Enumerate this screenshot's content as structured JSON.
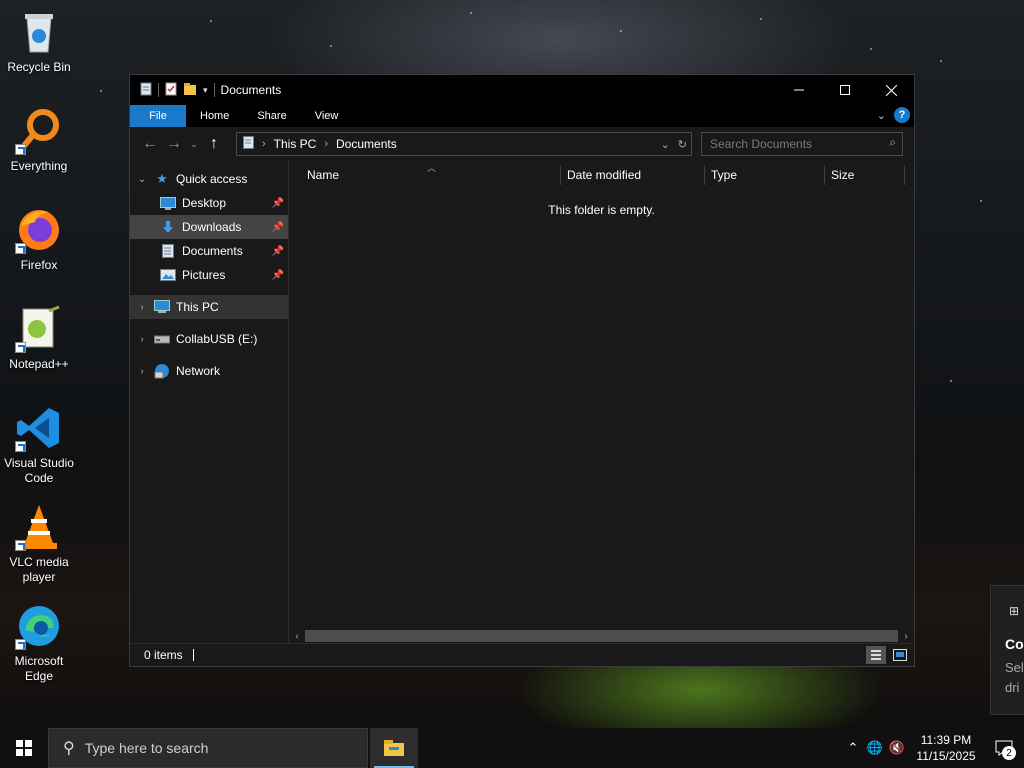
{
  "desktop": {
    "icons": [
      {
        "label": "Recycle Bin",
        "icon": "recycle-bin-icon"
      },
      {
        "label": "Everything",
        "icon": "everything-search-icon"
      },
      {
        "label": "Firefox",
        "icon": "firefox-icon"
      },
      {
        "label": "Notepad++",
        "icon": "notepad-plus-plus-icon"
      },
      {
        "label": "Visual Studio Code",
        "icon": "vscode-icon"
      },
      {
        "label": "VLC media player",
        "icon": "vlc-icon"
      },
      {
        "label": "Microsoft Edge",
        "icon": "edge-icon"
      }
    ]
  },
  "window": {
    "title": "Documents",
    "ribbon_tabs": [
      "File",
      "Home",
      "Share",
      "View"
    ],
    "address": {
      "segments": [
        "This PC",
        "Documents"
      ]
    },
    "search": {
      "placeholder": "Search Documents"
    },
    "nav": {
      "quick_access": "Quick access",
      "pinned": [
        "Desktop",
        "Downloads",
        "Documents",
        "Pictures"
      ],
      "this_pc": "This PC",
      "usb": "CollabUSB (E:)",
      "network": "Network"
    },
    "columns": [
      "Name",
      "Date modified",
      "Type",
      "Size"
    ],
    "empty_message": "This folder is empty.",
    "status": {
      "items": "0 items"
    }
  },
  "taskbar": {
    "search_placeholder": "Type here to search",
    "time": "11:39 PM",
    "date": "11/15/2025",
    "notification_count": "2"
  },
  "toast": {
    "title": "Co",
    "line1": "Sel",
    "line2": "dri"
  },
  "colors": {
    "accent": "#1979ca",
    "window_bg": "#191919",
    "taskbar_bg": "#101010"
  }
}
